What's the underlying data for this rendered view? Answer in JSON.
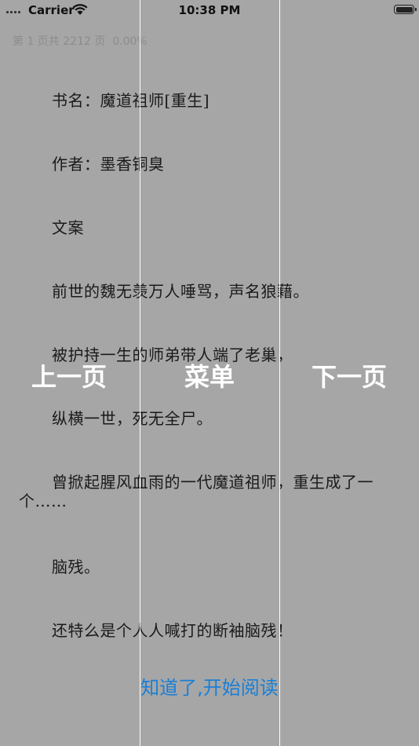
{
  "status_bar": {
    "carrier": "Carrier",
    "time": "10:38 PM"
  },
  "reader": {
    "page_info": "第 1 页共 2212 页  0.00%",
    "paragraphs": [
      "书名：魔道祖师[重生]",
      "作者：墨香铜臭",
      "文案",
      "前世的魏无羡万人唾骂，声名狼藉。",
      "被护持一生的师弟带人端了老巢，",
      "纵横一世，死无全尸。",
      "曾掀起腥风血雨的一代魔道祖师，重生成了一个……",
      "脑残。",
      "还特么是个人人喊打的断袖脑残！"
    ]
  },
  "overlay": {
    "prev_label": "上一页",
    "menu_label": "菜单",
    "next_label": "下一页",
    "start_label": "知道了,开始阅读"
  },
  "colors": {
    "background": "#a6a6a6",
    "overlay_text": "#ffffff",
    "accent": "#1a7fd6"
  }
}
